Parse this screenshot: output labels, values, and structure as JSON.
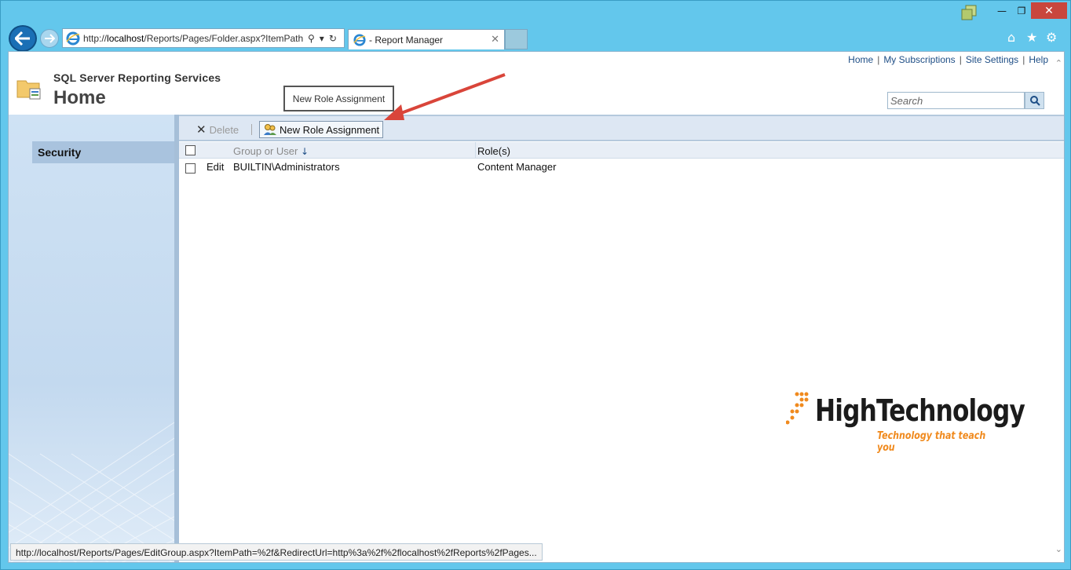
{
  "browser": {
    "address_url_prefix": "http://",
    "address_url_host": "localhost",
    "address_url_rest": "/Reports/Pages/Folder.aspx?ItemPath",
    "tab_title": "- Report Manager",
    "status_url": "http://localhost/Reports/Pages/EditGroup.aspx?ItemPath=%2f&RedirectUrl=http%3a%2f%2flocalhost%2fReports%2fPages..."
  },
  "toplinks": [
    "Home",
    "My Subscriptions",
    "Site Settings",
    "Help"
  ],
  "header": {
    "suite": "SQL Server Reporting Services",
    "title": "Home",
    "tooltip": "New Role Assignment",
    "search_placeholder": "Search"
  },
  "leftnav": {
    "active": "Security"
  },
  "toolbar": {
    "delete_label": "Delete",
    "new_role_label": "New Role Assignment"
  },
  "table": {
    "columns": {
      "user": "Group or User",
      "roles": "Role(s)"
    },
    "rows": [
      {
        "action": "Edit",
        "user": "BUILTIN\\Administrators",
        "roles": "Content Manager"
      }
    ]
  },
  "watermark": {
    "name": "HighTechnology",
    "tagline": "Technology that teach you"
  },
  "colors": {
    "frame": "#63c7ec",
    "accent_link": "#1d4d85",
    "logo_orange": "#f08a1e",
    "arrow": "#d9453a"
  },
  "icons": [
    "back-icon",
    "forward-icon",
    "ie-icon",
    "search-icon",
    "refresh-icon",
    "home-icon",
    "star-icon",
    "gear-icon",
    "folder-icon",
    "delete-icon",
    "add-user-icon",
    "sort-down-icon"
  ]
}
